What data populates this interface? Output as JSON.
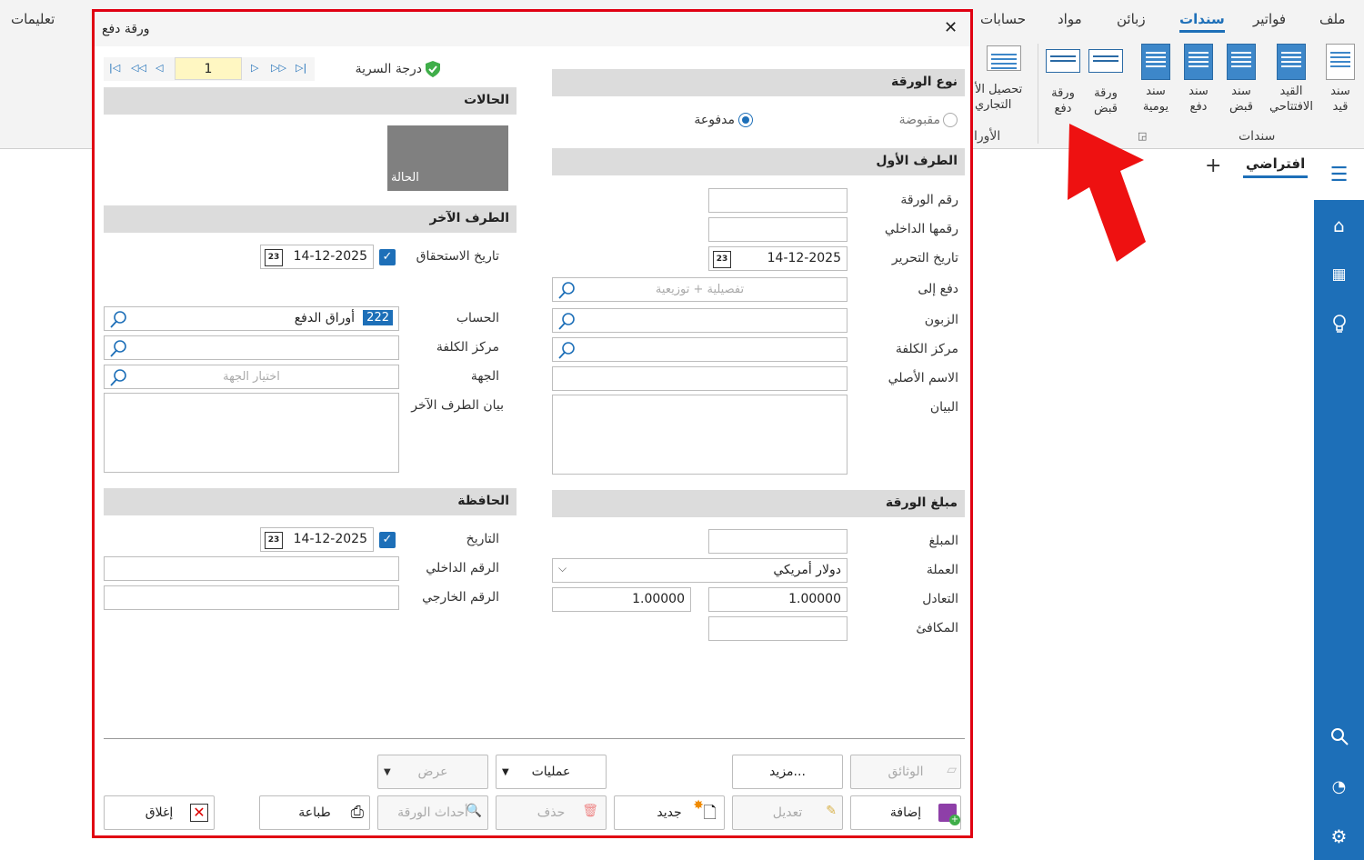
{
  "ribbon": {
    "menus": [
      "ملف",
      "فواتير",
      "سندات",
      "زبائن",
      "مواد",
      "حسابات",
      "تعليمات"
    ],
    "active_menu": "سندات",
    "buttons": [
      {
        "line1": "سند",
        "line2": "قيد"
      },
      {
        "line1": "القيد",
        "line2": "الافتتاحي"
      },
      {
        "line1": "سند",
        "line2": "قبض"
      },
      {
        "line1": "سند",
        "line2": "دفع"
      },
      {
        "line1": "سند",
        "line2": "يومية"
      },
      {
        "line1": "ورقة",
        "line2": "قبض"
      },
      {
        "line1": "ورقة",
        "line2": "دفع"
      },
      {
        "line1": "تحصيل الأ",
        "line2": "التجاري"
      }
    ],
    "group_vouchers": "سندات",
    "group_papers": "الأورا"
  },
  "workspace": {
    "tab": "افتراضي",
    "add": "+"
  },
  "dialog": {
    "title": "ورقة دفع",
    "close": "✕",
    "nav_value": "1",
    "privacy": "درجة السرية",
    "paper_type": {
      "header": "نوع الورقة",
      "opt_received": "مقبوضة",
      "opt_paid": "مدفوعة"
    },
    "first_party": {
      "header": "الطرف الأول",
      "paper_no": "رقم الورقة",
      "internal_no": "رقمها الداخلي",
      "issue_date": "تاريخ التحرير",
      "issue_date_value": "14-12-2025",
      "pay_to": "دفع إلى",
      "pay_to_ph": "تفصيلية + توزيعية",
      "customer": "الزبون",
      "cost_center": "مركز الكلفة",
      "original_name": "الاسم الأصلي",
      "statement": "البيان"
    },
    "states": {
      "header": "الحالات",
      "state": "الحالة"
    },
    "other_party": {
      "header": "الطرف الآخر",
      "due_date": "تاريخ الاستحقاق",
      "due_date_value": "14-12-2025",
      "account": "الحساب",
      "account_code": "222",
      "account_name": "أوراق الدفع",
      "cost_center": "مركز الكلفة",
      "entity": "الجهة",
      "entity_ph": "اختيار الجهة",
      "statement": "بيان الطرف الآخر"
    },
    "amount": {
      "header": "مبلغ الورقة",
      "amount": "المبلغ",
      "currency": "العملة",
      "currency_value": "دولار أمريكي",
      "rate": "التعادل",
      "rate_value1": "1.00000",
      "rate_value2": "1.00000",
      "equivalent": "المكافئ"
    },
    "portfolio": {
      "header": "الحافظة",
      "date": "التاريخ",
      "date_value": "14-12-2025",
      "internal_no": "الرقم الداخلي",
      "external_no": "الرقم الخارجي"
    },
    "buttons": {
      "documents": "الوثائق",
      "more": "مزيد...",
      "operations": "عمليات",
      "view": "عرض",
      "add": "إضافة",
      "edit": "تعديل",
      "new": "جديد",
      "delete": "حذف",
      "paper_events": "أحداث الورقة",
      "print": "طباعة",
      "close": "إغلاق"
    }
  }
}
